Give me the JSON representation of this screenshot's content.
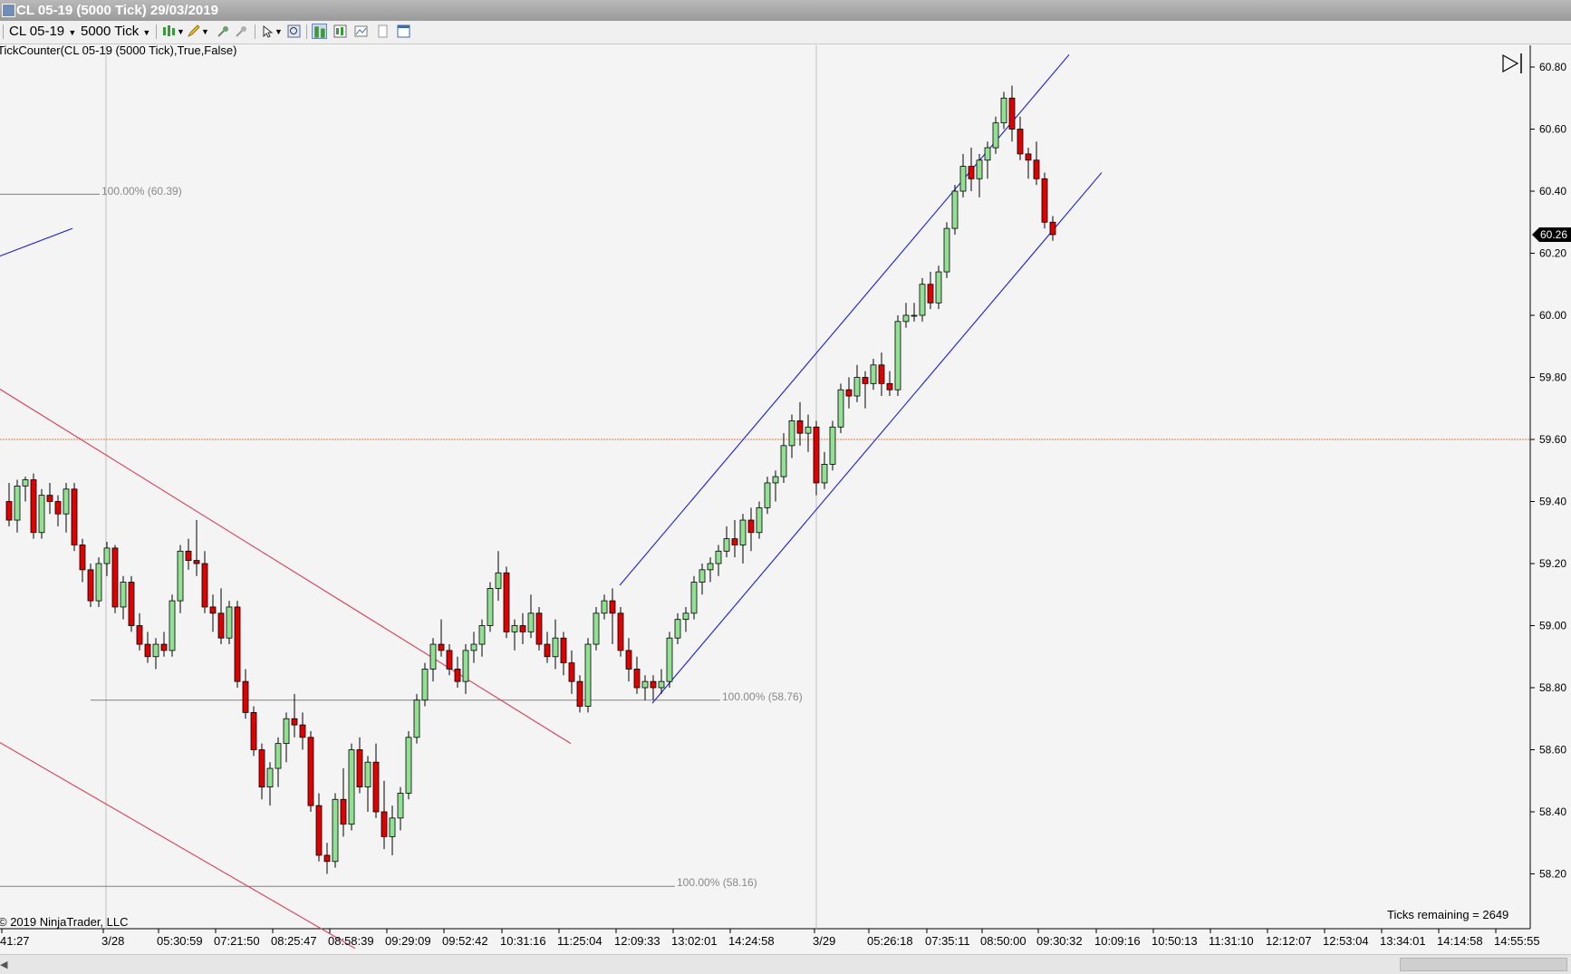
{
  "window": {
    "title": "CL 05-19 (5000 Tick)  29/03/2019"
  },
  "toolbar": {
    "instrument": "CL 05-19",
    "interval": "5000 Tick"
  },
  "chart": {
    "indicator_label": "TickCounter(CL 05-19 (5000 Tick),True,False)",
    "copyright": "© 2019 NinjaTrader, LLC",
    "ticks_remaining": "Ticks remaining = 2649",
    "current_price_label": "60.26",
    "fib_labels": [
      "100.00% (60.39)",
      "100.00% (58.76)",
      "100.00% (58.16)"
    ],
    "y_ticks": [
      "60.80",
      "60.60",
      "60.40",
      "60.20",
      "60.00",
      "59.80",
      "59.60",
      "59.40",
      "59.20",
      "59.00",
      "58.80",
      "58.60",
      "58.40",
      "58.20"
    ],
    "x_ticks": [
      "41:27",
      "3/28",
      "05:30:59",
      "07:21:50",
      "08:25:47",
      "08:58:39",
      "09:29:09",
      "09:52:42",
      "10:31:16",
      "11:25:04",
      "12:09:33",
      "13:02:01",
      "14:24:58",
      "3/29",
      "05:26:18",
      "07:35:11",
      "08:50:00",
      "09:30:32",
      "10:09:16",
      "10:50:13",
      "11:31:10",
      "12:12:07",
      "12:53:04",
      "13:34:01",
      "14:14:58",
      "14:55:55"
    ]
  },
  "chart_data": {
    "type": "candlestick",
    "instrument": "CL 05-19",
    "interval": "5000 Tick",
    "ylim": [
      58.12,
      60.88
    ],
    "last_price": 60.26,
    "horizontal_level": 59.6,
    "colors": {
      "up": "#92e092",
      "down": "#e00000",
      "outline": "#000000",
      "channel": "#1a1ae0",
      "downtrend": "#dc3c5a",
      "level": "#e08040"
    },
    "candles": [
      [
        59.4,
        59.46,
        59.32,
        59.34
      ],
      [
        59.34,
        59.47,
        59.3,
        59.45
      ],
      [
        59.45,
        59.48,
        59.4,
        59.47
      ],
      [
        59.47,
        59.49,
        59.28,
        59.3
      ],
      [
        59.3,
        59.44,
        59.28,
        59.42
      ],
      [
        59.42,
        59.46,
        59.36,
        59.4
      ],
      [
        59.4,
        59.42,
        59.32,
        59.36
      ],
      [
        59.36,
        59.46,
        59.3,
        59.44
      ],
      [
        59.44,
        59.46,
        59.24,
        59.26
      ],
      [
        59.26,
        59.28,
        59.14,
        59.18
      ],
      [
        59.18,
        59.2,
        59.06,
        59.08
      ],
      [
        59.08,
        59.22,
        59.06,
        59.2
      ],
      [
        59.2,
        59.27,
        59.16,
        59.25
      ],
      [
        59.25,
        59.26,
        59.04,
        59.06
      ],
      [
        59.06,
        59.16,
        59.02,
        59.14
      ],
      [
        59.14,
        59.16,
        58.98,
        59.0
      ],
      [
        59.0,
        59.04,
        58.92,
        58.94
      ],
      [
        58.94,
        58.98,
        58.88,
        58.9
      ],
      [
        58.9,
        58.96,
        58.86,
        58.94
      ],
      [
        58.94,
        58.98,
        58.9,
        58.92
      ],
      [
        58.92,
        59.1,
        58.9,
        59.08
      ],
      [
        59.08,
        59.26,
        59.04,
        59.24
      ],
      [
        59.24,
        59.28,
        59.18,
        59.21
      ],
      [
        59.21,
        59.34,
        59.16,
        59.2
      ],
      [
        59.2,
        59.24,
        59.04,
        59.06
      ],
      [
        59.06,
        59.1,
        58.98,
        59.04
      ],
      [
        59.04,
        59.12,
        58.94,
        58.96
      ],
      [
        58.96,
        59.08,
        58.94,
        59.06
      ],
      [
        59.06,
        59.08,
        58.8,
        58.82
      ],
      [
        58.82,
        58.86,
        58.7,
        58.72
      ],
      [
        58.72,
        58.74,
        58.58,
        58.6
      ],
      [
        58.6,
        58.62,
        58.44,
        58.48
      ],
      [
        58.48,
        58.56,
        58.42,
        58.54
      ],
      [
        58.54,
        58.64,
        58.48,
        58.62
      ],
      [
        58.62,
        58.72,
        58.56,
        58.7
      ],
      [
        58.7,
        58.78,
        58.64,
        58.68
      ],
      [
        58.68,
        58.72,
        58.6,
        58.64
      ],
      [
        58.64,
        58.66,
        58.4,
        58.42
      ],
      [
        58.42,
        58.46,
        58.24,
        58.26
      ],
      [
        58.26,
        58.3,
        58.2,
        58.24
      ],
      [
        58.24,
        58.46,
        58.22,
        58.44
      ],
      [
        58.44,
        58.54,
        58.32,
        58.36
      ],
      [
        58.36,
        58.62,
        58.34,
        58.6
      ],
      [
        58.6,
        58.64,
        58.46,
        58.48
      ],
      [
        58.48,
        58.58,
        58.4,
        58.56
      ],
      [
        58.56,
        58.62,
        58.38,
        58.4
      ],
      [
        58.4,
        58.5,
        58.28,
        58.32
      ],
      [
        58.32,
        58.42,
        58.26,
        58.38
      ],
      [
        58.38,
        58.48,
        58.34,
        58.46
      ],
      [
        58.46,
        58.66,
        58.44,
        58.64
      ],
      [
        58.64,
        58.78,
        58.62,
        58.76
      ],
      [
        58.76,
        58.88,
        58.74,
        58.86
      ],
      [
        58.86,
        58.96,
        58.82,
        58.94
      ],
      [
        58.94,
        59.02,
        58.9,
        58.92
      ],
      [
        58.92,
        58.94,
        58.84,
        58.86
      ],
      [
        58.86,
        58.9,
        58.8,
        58.82
      ],
      [
        58.82,
        58.94,
        58.78,
        58.92
      ],
      [
        58.92,
        58.98,
        58.88,
        58.94
      ],
      [
        58.94,
        59.02,
        58.9,
        59.0
      ],
      [
        59.0,
        59.14,
        58.98,
        59.12
      ],
      [
        59.12,
        59.24,
        59.08,
        59.17
      ],
      [
        59.17,
        59.19,
        58.96,
        58.98
      ],
      [
        58.98,
        59.02,
        58.92,
        59.0
      ],
      [
        59.0,
        59.04,
        58.94,
        58.98
      ],
      [
        58.98,
        59.1,
        58.96,
        59.04
      ],
      [
        59.04,
        59.06,
        58.92,
        58.94
      ],
      [
        58.94,
        58.98,
        58.88,
        58.9
      ],
      [
        58.9,
        59.02,
        58.86,
        58.96
      ],
      [
        58.96,
        58.98,
        58.84,
        58.88
      ],
      [
        58.88,
        58.92,
        58.78,
        58.82
      ],
      [
        58.82,
        58.84,
        58.72,
        58.74
      ],
      [
        58.74,
        58.96,
        58.72,
        58.94
      ],
      [
        58.94,
        59.06,
        58.92,
        59.04
      ],
      [
        59.04,
        59.1,
        59.02,
        59.08
      ],
      [
        59.08,
        59.12,
        58.94,
        59.04
      ],
      [
        59.04,
        59.06,
        58.9,
        58.92
      ],
      [
        58.92,
        58.96,
        58.82,
        58.86
      ],
      [
        58.86,
        58.9,
        58.78,
        58.8
      ],
      [
        58.8,
        58.84,
        58.76,
        58.82
      ],
      [
        58.82,
        58.84,
        58.76,
        58.8
      ],
      [
        58.8,
        58.86,
        58.78,
        58.82
      ],
      [
        58.82,
        58.98,
        58.8,
        58.96
      ],
      [
        58.96,
        59.04,
        58.94,
        59.02
      ],
      [
        59.02,
        59.06,
        58.98,
        59.04
      ],
      [
        59.04,
        59.16,
        59.02,
        59.14
      ],
      [
        59.14,
        59.2,
        59.1,
        59.18
      ],
      [
        59.18,
        59.22,
        59.14,
        59.2
      ],
      [
        59.2,
        59.26,
        59.16,
        59.24
      ],
      [
        59.24,
        59.32,
        59.22,
        59.28
      ],
      [
        59.28,
        59.34,
        59.22,
        59.26
      ],
      [
        59.26,
        59.36,
        59.2,
        59.34
      ],
      [
        59.34,
        59.38,
        59.24,
        59.3
      ],
      [
        59.3,
        59.4,
        59.28,
        59.38
      ],
      [
        59.38,
        59.48,
        59.36,
        59.46
      ],
      [
        59.46,
        59.5,
        59.4,
        59.48
      ],
      [
        59.48,
        59.62,
        59.46,
        59.58
      ],
      [
        59.58,
        59.68,
        59.54,
        59.66
      ],
      [
        59.66,
        59.72,
        59.58,
        59.62
      ],
      [
        59.62,
        59.68,
        59.56,
        59.64
      ],
      [
        59.64,
        59.66,
        59.42,
        59.46
      ],
      [
        59.46,
        59.56,
        59.44,
        59.52
      ],
      [
        59.52,
        59.66,
        59.5,
        59.64
      ],
      [
        59.64,
        59.78,
        59.62,
        59.76
      ],
      [
        59.76,
        59.8,
        59.7,
        59.74
      ],
      [
        59.74,
        59.84,
        59.72,
        59.8
      ],
      [
        59.8,
        59.82,
        59.7,
        59.78
      ],
      [
        59.78,
        59.86,
        59.76,
        59.84
      ],
      [
        59.84,
        59.88,
        59.74,
        59.78
      ],
      [
        59.78,
        59.82,
        59.74,
        59.76
      ],
      [
        59.76,
        60.0,
        59.74,
        59.98
      ],
      [
        59.98,
        60.04,
        59.96,
        60.0
      ],
      [
        60.0,
        60.04,
        59.98,
        60.0
      ],
      [
        60.0,
        60.12,
        59.98,
        60.1
      ],
      [
        60.1,
        60.14,
        60.02,
        60.04
      ],
      [
        60.04,
        60.16,
        60.02,
        60.14
      ],
      [
        60.14,
        60.3,
        60.12,
        60.28
      ],
      [
        60.28,
        60.42,
        60.26,
        60.4
      ],
      [
        60.4,
        60.52,
        60.38,
        60.48
      ],
      [
        60.48,
        60.54,
        60.4,
        60.44
      ],
      [
        60.44,
        60.52,
        60.38,
        60.5
      ],
      [
        60.5,
        60.56,
        60.44,
        60.54
      ],
      [
        60.54,
        60.64,
        60.52,
        60.62
      ],
      [
        60.62,
        60.72,
        60.6,
        60.7
      ],
      [
        60.7,
        60.74,
        60.56,
        60.6
      ],
      [
        60.6,
        60.64,
        60.5,
        60.52
      ],
      [
        60.52,
        60.54,
        60.44,
        60.5
      ],
      [
        60.5,
        60.56,
        60.42,
        60.44
      ],
      [
        60.44,
        60.46,
        60.28,
        60.3
      ],
      [
        60.3,
        60.32,
        60.24,
        60.26
      ]
    ],
    "fib_levels": [
      60.39,
      58.76,
      58.16
    ]
  }
}
